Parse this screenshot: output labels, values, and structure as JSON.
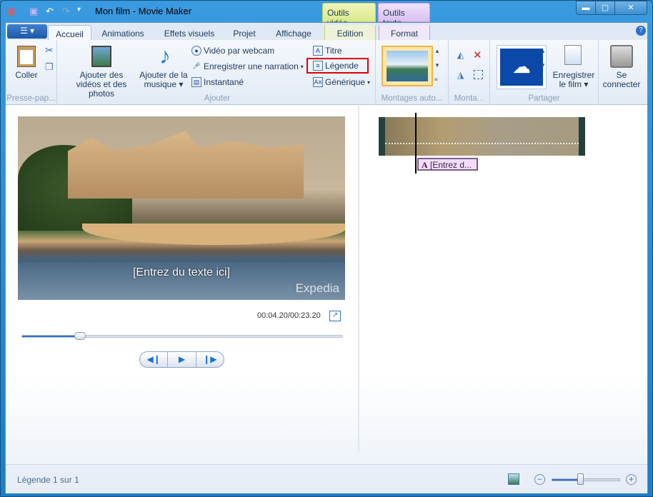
{
  "window": {
    "title": "Mon film - Movie Maker",
    "controls": [
      "minimize",
      "maximize",
      "close"
    ]
  },
  "quick_access": [
    "app-icon",
    "save-icon",
    "undo-icon",
    "redo-icon",
    "customize-icon"
  ],
  "context_tabs": {
    "video_tools": "Outils vidéo",
    "text_tools": "Outils texte",
    "video_color": "#e6f0a4",
    "text_color": "#e3cdf3"
  },
  "tabs": [
    {
      "label": "Accueil",
      "active": true
    },
    {
      "label": "Animations"
    },
    {
      "label": "Effets visuels"
    },
    {
      "label": "Projet"
    },
    {
      "label": "Affichage"
    },
    {
      "label": "Edition"
    },
    {
      "label": "Format"
    }
  ],
  "ribbon": {
    "clipboard": {
      "label": "Presse-pap...",
      "paste": "Coller"
    },
    "add": {
      "label": "Ajouter",
      "add_videos": "Ajouter des vidéos et des photos",
      "add_music": "Ajouter de la musique",
      "webcam": "Vidéo par webcam",
      "narration": "Enregistrer une narration",
      "snapshot": "Instantané",
      "title": "Titre",
      "caption": "Légende",
      "credits": "Générique"
    },
    "automovie": {
      "label": "Montages auto..."
    },
    "editing": {
      "label": "Monta..."
    },
    "share": {
      "label": "Partager",
      "save_movie": "Enregistrer le film"
    },
    "sign_in": "Se connecter"
  },
  "preview": {
    "caption_text": "[Entrez du texte ici]",
    "watermark": "Expedia",
    "time": "00:04.20/00:23.20",
    "progress": 0.18
  },
  "storyboard": {
    "caption_clip": "[Entrez d..."
  },
  "statusbar": {
    "text": "Légende 1 sur 1",
    "zoom_level": 0.42
  },
  "highlight_color": "#e00000"
}
